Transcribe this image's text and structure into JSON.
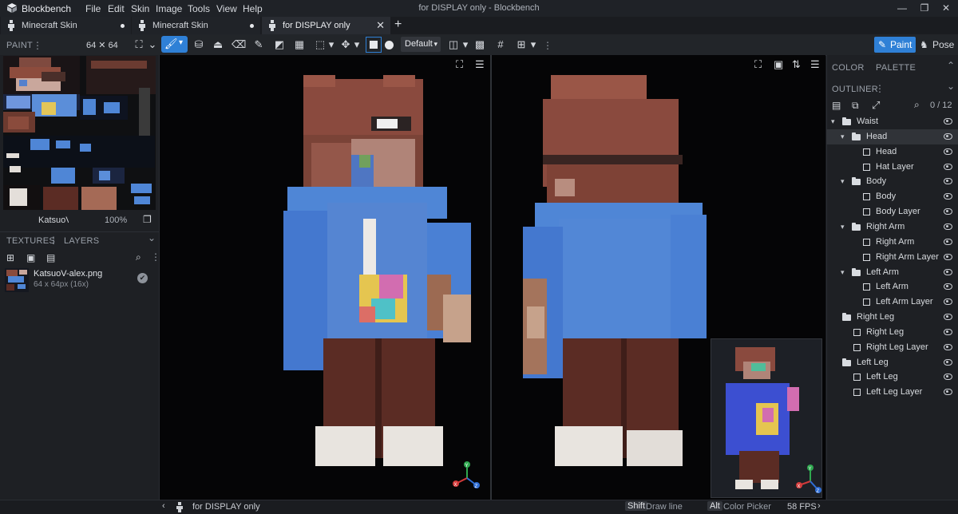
{
  "app": {
    "name": "Blockbench",
    "window_title": "for DISPLAY only - Blockbench"
  },
  "menu": [
    "File",
    "Edit",
    "Skin",
    "Image",
    "Tools",
    "View",
    "Help"
  ],
  "tabs": [
    {
      "label": "Minecraft Skin"
    },
    {
      "label": "Minecraft Skin"
    },
    {
      "label": "for DISPLAY only"
    }
  ],
  "toolbar": {
    "paint_label": "PAINT",
    "canvas_size": "64 ✕ 64",
    "brush_mode": "Default",
    "mode_paint": "Paint",
    "mode_pose": "Pose"
  },
  "texture_preview": {
    "filename": "KatsuoV-ale",
    "zoom": "100%"
  },
  "textures_panel": {
    "tab_textures": "TEXTURES",
    "tab_layers": "LAYERS",
    "items": [
      {
        "name": "KatsuoV-alex.png",
        "meta": "64 x 64px (16x)"
      }
    ]
  },
  "right_panel": {
    "tab_color": "COLOR",
    "tab_palette": "PALETTE",
    "outliner_label": "OUTLINER",
    "count": "0 / 12",
    "outliner": [
      {
        "label": "Waist",
        "kind": "group",
        "depth": 0,
        "open": true
      },
      {
        "label": "Head",
        "kind": "group",
        "depth": 1,
        "open": true,
        "selected": true
      },
      {
        "label": "Head",
        "kind": "cube",
        "depth": 2
      },
      {
        "label": "Hat Layer",
        "kind": "cube",
        "depth": 2
      },
      {
        "label": "Body",
        "kind": "group",
        "depth": 1,
        "open": true
      },
      {
        "label": "Body",
        "kind": "cube",
        "depth": 2
      },
      {
        "label": "Body Layer",
        "kind": "cube",
        "depth": 2
      },
      {
        "label": "Right Arm",
        "kind": "group",
        "depth": 1,
        "open": true
      },
      {
        "label": "Right Arm",
        "kind": "cube",
        "depth": 2
      },
      {
        "label": "Right Arm Layer",
        "kind": "cube",
        "depth": 2
      },
      {
        "label": "Left Arm",
        "kind": "group",
        "depth": 1,
        "open": true
      },
      {
        "label": "Left Arm",
        "kind": "cube",
        "depth": 2
      },
      {
        "label": "Left Arm Layer",
        "kind": "cube",
        "depth": 2
      },
      {
        "label": "Right Leg",
        "kind": "group",
        "depth": 0,
        "open": false
      },
      {
        "label": "Right Leg",
        "kind": "cube",
        "depth": 1
      },
      {
        "label": "Right Leg Layer",
        "kind": "cube",
        "depth": 1
      },
      {
        "label": "Left Leg",
        "kind": "group",
        "depth": 0,
        "open": false
      },
      {
        "label": "Left Leg",
        "kind": "cube",
        "depth": 1
      },
      {
        "label": "Left Leg Layer",
        "kind": "cube",
        "depth": 1
      }
    ]
  },
  "statusbar": {
    "project": "for DISPLAY only",
    "shift_key": "Shift",
    "shift_action": "Draw line",
    "alt_key": "Alt",
    "alt_action": "Color Picker",
    "fps": "58 FPS"
  },
  "gizmo_axes": [
    "X",
    "Y",
    "Z"
  ],
  "colors": {
    "accent": "#2f80d6",
    "hoodie": "#4f86d6",
    "hair": "#8a4a3e",
    "pants": "#5b2c24",
    "shoes": "#e8e4df"
  }
}
